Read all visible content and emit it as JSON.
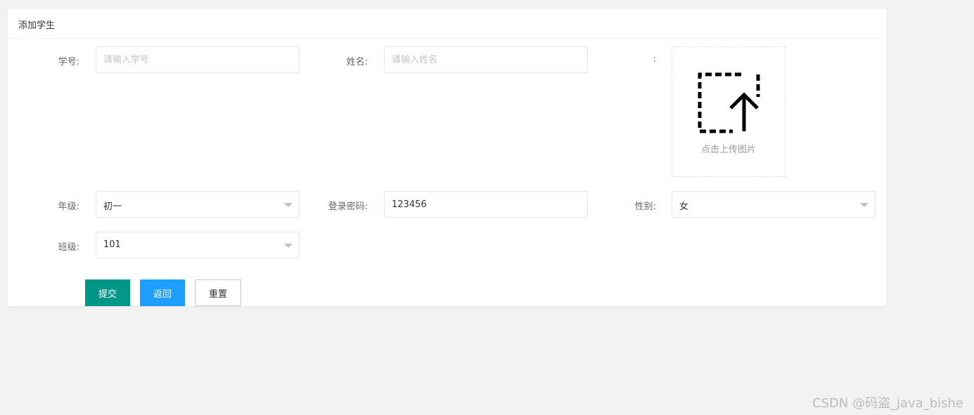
{
  "panel": {
    "title": "添加学生"
  },
  "form": {
    "student_id": {
      "label": "学号:",
      "placeholder": "请输入学号",
      "value": ""
    },
    "name": {
      "label": "姓名:",
      "placeholder": "请输入姓名",
      "value": ""
    },
    "photo": {
      "label": ":",
      "upload_text": "点击上传图片"
    },
    "grade": {
      "label": "年级:",
      "value": "初一"
    },
    "password": {
      "label": "登录密码:",
      "value": "123456"
    },
    "gender": {
      "label": "性别:",
      "value": "女"
    },
    "class": {
      "label": "班级:",
      "value": "101"
    }
  },
  "buttons": {
    "submit": "提交",
    "back": "返回",
    "reset": "重置"
  },
  "colors": {
    "submit": "#009688",
    "back": "#1e9fff",
    "background": "#f2f2f2"
  },
  "icons": {
    "upload": "upload-icon",
    "caret": "chevron-down-icon"
  },
  "watermark": "CSDN @码盗_java_bishe"
}
